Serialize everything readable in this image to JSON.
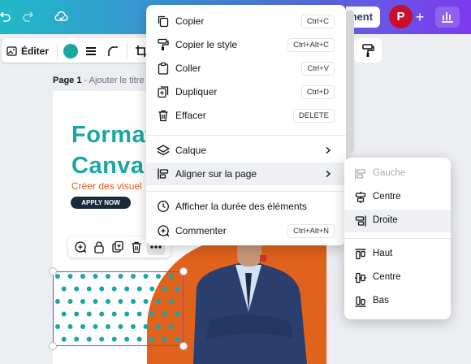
{
  "topbar": {
    "share_label": "ment",
    "avatar_initial": "P",
    "plus_label": "+"
  },
  "toolbar": {
    "edit_label": "Éditer",
    "color_swatch": "#1aa7a3"
  },
  "page": {
    "label": "Page 1",
    "sub_label": " - Ajouter le titre"
  },
  "design": {
    "title_line1": "Format",
    "title_line2": "Canva",
    "subtitle": "Créer des visuel",
    "cta": "APPLY NOW",
    "accent_teal": "#1aa7a3",
    "accent_orange": "#e0621c",
    "cta_bg": "#1b2a3a"
  },
  "context_menu": {
    "items": [
      {
        "label": "Copier",
        "shortcut": "Ctrl+C"
      },
      {
        "label": "Copier le style",
        "shortcut": "Ctrl+Alt+C"
      },
      {
        "label": "Coller",
        "shortcut": "Ctrl+V"
      },
      {
        "label": "Dupliquer",
        "shortcut": "Ctrl+D"
      },
      {
        "label": "Effacer",
        "shortcut": "DELETE"
      },
      {
        "label": "Calque"
      },
      {
        "label": "Aligner sur la page"
      },
      {
        "label": "Afficher la durée des éléments"
      },
      {
        "label": "Commenter",
        "shortcut": "Ctrl+Alt+N"
      }
    ]
  },
  "submenu": {
    "items": [
      {
        "label": "Gauche"
      },
      {
        "label": "Centre"
      },
      {
        "label": "Droite"
      },
      {
        "label": "Haut"
      },
      {
        "label": "Centre"
      },
      {
        "label": "Bas"
      }
    ]
  },
  "selection_color": "#8b3dff"
}
